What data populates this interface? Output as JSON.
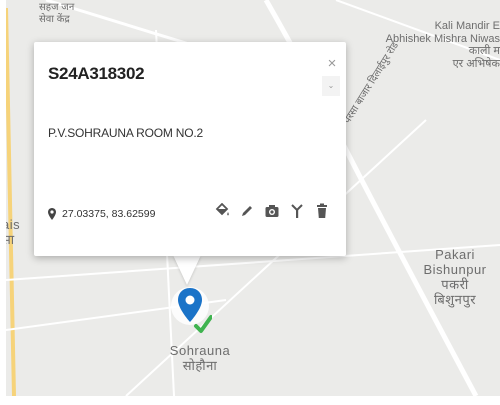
{
  "map": {
    "labels": {
      "top_left_line1": "सहज जन",
      "top_left_line2": "सेवा केंद्र",
      "kali_mandir": "Kali Mandir E",
      "abhishek": "Abhishek Mishra Niwas",
      "kali_hi": "काली म",
      "abhishek_hi": "एर अभिषेक",
      "road": "परसा बाजार दिलाईपुर रोड",
      "left_partial1": "ais",
      "left_partial2": "सा",
      "pakari": "Pakari",
      "bishunpur": "Bishunpur",
      "pakari_hi": "पकरी",
      "bishunpur_hi": "बिशुनपुर",
      "sohrauna": "Sohrauna",
      "sohrauna_hi": "सोहौना"
    },
    "colors": {
      "background": "#ebebe9",
      "road": "#ffffff",
      "label": "#6d6d6d",
      "marker": "#1a73c8",
      "check": "#3fb34f"
    }
  },
  "popup": {
    "site_id": "S24A318302",
    "address": "P.V.SOHRAUNA ROOM NO.2",
    "coordinates": "27.03375, 83.62599",
    "close_glyph": "×",
    "scroll_glyph": "⌄",
    "tools": [
      "paint-bucket-icon",
      "pencil-icon",
      "camera-icon",
      "antenna-icon",
      "trash-icon"
    ]
  }
}
